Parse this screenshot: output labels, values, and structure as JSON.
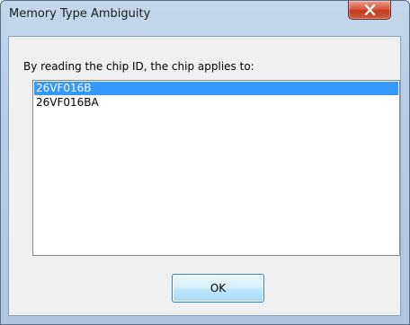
{
  "window": {
    "title": "Memory Type Ambiguity",
    "close_icon": "close-icon"
  },
  "dialog": {
    "prompt": "By reading the chip ID, the chip applies to:",
    "options": [
      {
        "label": "26VF016B",
        "selected": true
      },
      {
        "label": "26VF016BA",
        "selected": false
      }
    ],
    "ok_label": "OK"
  },
  "colors": {
    "selection": "#3399ff",
    "close_button": "#c23a1f",
    "frame": "#b7cde6"
  }
}
